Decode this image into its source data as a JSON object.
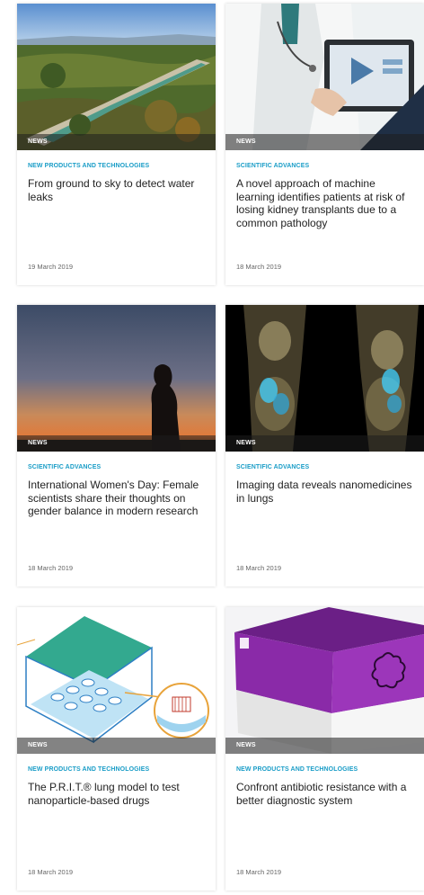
{
  "cards": [
    {
      "badge": "NEWS",
      "category": "NEW PRODUCTS AND TECHNOLOGIES",
      "title": "From ground to sky to detect water leaks",
      "date": "19 March 2019",
      "image": "aerial-canal-landscape"
    },
    {
      "badge": "NEWS",
      "category": "SCIENTIFIC ADVANCES",
      "title": "A novel approach of machine learning identifies patients at risk of losing kidney transplants due to a common pathology",
      "date": "18 March 2019",
      "image": "doctor-with-tablet"
    },
    {
      "badge": "NEWS",
      "category": "SCIENTIFIC ADVANCES",
      "title": "International Women's Day: Female scientists share their thoughts on gender balance in modern research",
      "date": "18 March 2019",
      "image": "woman-silhouette-sunset"
    },
    {
      "badge": "NEWS",
      "category": "SCIENTIFIC ADVANCES",
      "title": "Imaging data reveals nanomedicines in lungs",
      "date": "18 March 2019",
      "image": "mouse-lung-imaging-scan"
    },
    {
      "badge": "NEWS",
      "category": "NEW PRODUCTS AND TECHNOLOGIES",
      "title": "The P.R.I.T.® lung model to test nanoparticle-based drugs",
      "date": "18 March 2019",
      "image": "lung-model-diagram"
    },
    {
      "badge": "NEWS",
      "category": "NEW PRODUCTS AND TECHNOLOGIES",
      "title": "Confront antibiotic resistance with a better diagnostic system",
      "date": "18 March 2019",
      "image": "diagnostic-product-box"
    }
  ],
  "colors": {
    "category": "#1a9dc7",
    "title": "#222222",
    "date": "#666666"
  }
}
